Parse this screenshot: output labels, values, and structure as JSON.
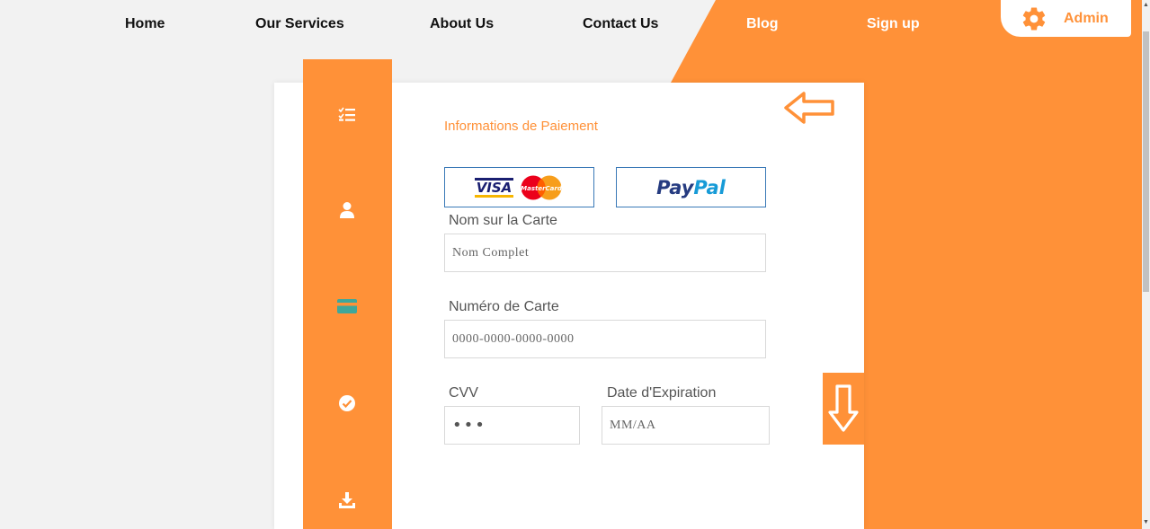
{
  "nav": {
    "items": [
      {
        "label": "Home"
      },
      {
        "label": "Our Services"
      },
      {
        "label": "About Us"
      },
      {
        "label": "Contact Us"
      },
      {
        "label": "Blog"
      },
      {
        "label": "Sign up"
      }
    ],
    "admin_label": "Admin"
  },
  "sidebar": {
    "icons": [
      "checklist-icon",
      "user-icon",
      "credit-card-icon",
      "check-circle-icon",
      "download-icon"
    ],
    "active_index": 2
  },
  "form": {
    "title": "Informations de Paiement",
    "payment_options": {
      "card_visa": "VISA",
      "card_mastercard": "MasterCard",
      "paypal_part1": "Pay",
      "paypal_part2": "Pal"
    },
    "name_label": "Nom sur la Carte",
    "name_placeholder": "Nom Complet",
    "number_label": "Numéro de Carte",
    "number_placeholder": "0000-0000-0000-0000",
    "cvv_label": "CVV",
    "cvv_value": "•••",
    "expiry_label": "Date d'Expiration",
    "expiry_placeholder": "MM/AA"
  },
  "colors": {
    "accent": "#ff9138",
    "active_icon": "#3fa79a",
    "option_border": "#3a79b7"
  }
}
